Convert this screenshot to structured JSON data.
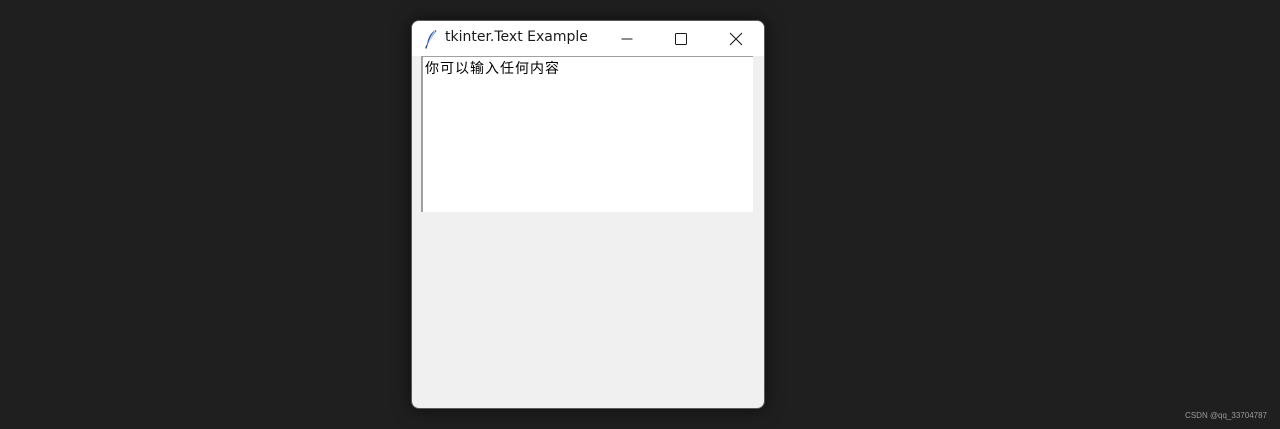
{
  "window": {
    "title": "tkinter.Text Example",
    "icon": "feather-icon",
    "controls": {
      "minimize": "minimize-icon",
      "maximize": "maximize-icon",
      "close": "close-icon"
    }
  },
  "text_widget": {
    "content": "你可以输入任何内容"
  },
  "watermark": {
    "text": "CSDN @qq_33704787"
  },
  "colors": {
    "desktop_bg": "#1f1f1f",
    "window_bg": "#f0f0f0",
    "titlebar_bg": "#ffffff",
    "text_bg": "#ffffff",
    "icon_blue": "#2f5fa8"
  }
}
